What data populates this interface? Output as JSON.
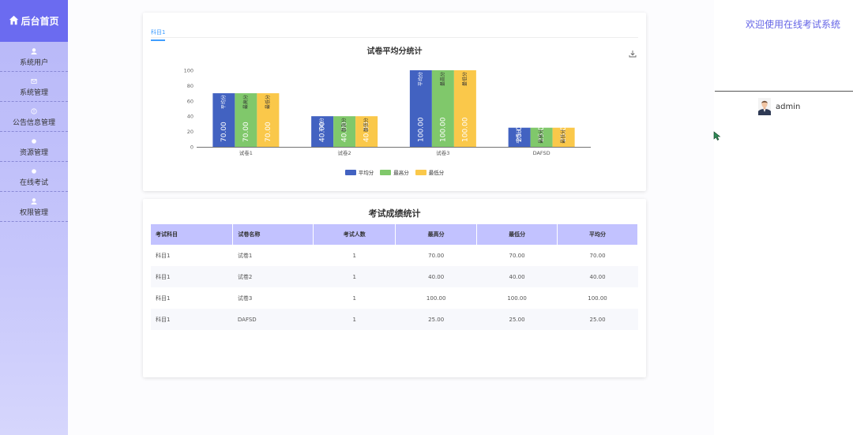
{
  "sidebar": {
    "title": "后台首页",
    "items": [
      {
        "label": "系统用户",
        "icon": "user-icon"
      },
      {
        "label": "系统管理",
        "icon": "mail-icon"
      },
      {
        "label": "公告信息管理",
        "icon": "info-circle-icon"
      },
      {
        "label": "资源管理",
        "icon": "dot-icon"
      },
      {
        "label": "在线考试",
        "icon": "dot-icon"
      },
      {
        "label": "权限管理",
        "icon": "user-icon"
      }
    ]
  },
  "header": {
    "welcome": "欢迎使用在线考试系统",
    "username": "admin"
  },
  "chart_card": {
    "tab": "科目1"
  },
  "chart_data": {
    "type": "bar",
    "title": "试卷平均分统计",
    "categories": [
      "试卷1",
      "试卷2",
      "试卷3",
      "DAFSD"
    ],
    "series": [
      {
        "name": "平均分",
        "values": [
          70,
          40,
          100,
          25
        ],
        "color": "#4262c1"
      },
      {
        "name": "最高分",
        "values": [
          70,
          40,
          100,
          25
        ],
        "color": "#80c86b"
      },
      {
        "name": "最低分",
        "values": [
          70,
          40,
          100,
          25
        ],
        "color": "#fac84a"
      }
    ],
    "value_labels": [
      "70.00",
      "40.00",
      "100.00",
      "25.00"
    ],
    "ylim": [
      0,
      100
    ],
    "yticks": [
      "0",
      "20",
      "40",
      "60",
      "80",
      "100"
    ],
    "grid": false,
    "legend": "bottom-center"
  },
  "table": {
    "title": "考试成绩统计",
    "columns": [
      "考试科目",
      "试卷名称",
      "考试人数",
      "最高分",
      "最低分",
      "平均分"
    ],
    "rows": [
      [
        "科目1",
        "试卷1",
        "1",
        "70.00",
        "70.00",
        "70.00"
      ],
      [
        "科目1",
        "试卷2",
        "1",
        "40.00",
        "40.00",
        "40.00"
      ],
      [
        "科目1",
        "试卷3",
        "1",
        "100.00",
        "100.00",
        "100.00"
      ],
      [
        "科目1",
        "DAFSD",
        "1",
        "25.00",
        "25.00",
        "25.00"
      ]
    ]
  }
}
